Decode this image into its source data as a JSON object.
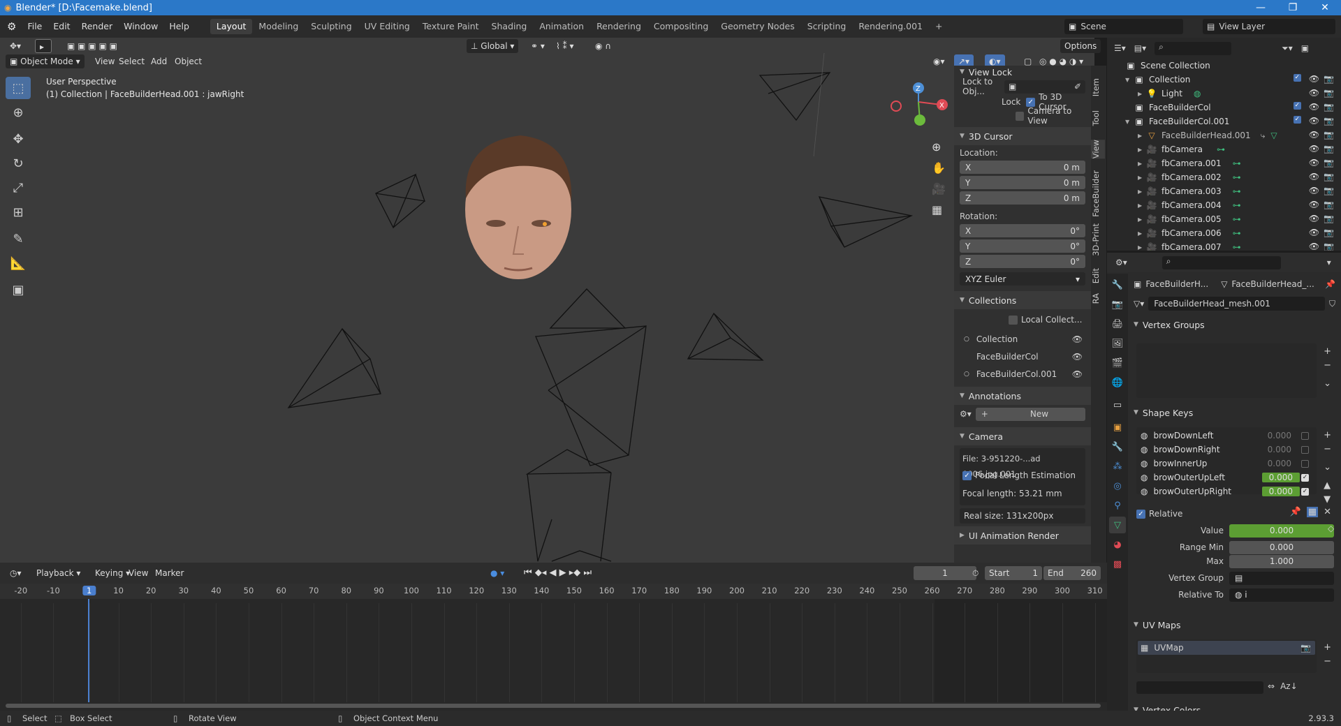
{
  "titlebar": {
    "title": "Blender* [D:\\Facemake.blend]",
    "minimize": "—",
    "restore": "❐",
    "close": "✕"
  },
  "menu": [
    "File",
    "Edit",
    "Render",
    "Window",
    "Help"
  ],
  "workspaces": [
    "Layout",
    "Modeling",
    "Sculpting",
    "UV Editing",
    "Texture Paint",
    "Shading",
    "Animation",
    "Rendering",
    "Compositing",
    "Geometry Nodes",
    "Scripting",
    "Rendering.001",
    "+"
  ],
  "active_workspace": "Layout",
  "scene": {
    "name": "Scene",
    "view_layer": "View Layer"
  },
  "viewport": {
    "mode": "Object Mode",
    "menus": [
      "View",
      "Select",
      "Add",
      "Object"
    ],
    "transform": "Global",
    "options": "Options",
    "overlay_line1": "User Perspective",
    "overlay_line2": "(1) Collection | FaceBuilderHead.001 : jawRight",
    "gizmo": {
      "x": "X",
      "y": "Y",
      "z": "Z"
    }
  },
  "npanel": {
    "view_lock_title": "View Lock",
    "lock_to_obj": "Lock to Obj...",
    "lock": "Lock",
    "to_3d_cursor": "To 3D Cursor",
    "camera_to_view": "Camera to View",
    "cursor_title": "3D Cursor",
    "location": "Location:",
    "rotation": "Rotation:",
    "loc": [
      {
        "axis": "X",
        "val": "0 m"
      },
      {
        "axis": "Y",
        "val": "0 m"
      },
      {
        "axis": "Z",
        "val": "0 m"
      }
    ],
    "rot": [
      {
        "axis": "X",
        "val": "0°"
      },
      {
        "axis": "Y",
        "val": "0°"
      },
      {
        "axis": "Z",
        "val": "0°"
      }
    ],
    "rot_mode": "XYZ Euler",
    "collections_title": "Collections",
    "local_collect": "Local Collect...",
    "collections": [
      "Collection",
      "FaceBuilderCol",
      "FaceBuilderCol.001"
    ],
    "annotations_title": "Annotations",
    "new": "New",
    "camera_title": "Camera",
    "file": "File: 3-951220-...ad 0006.jpg.001",
    "focal_est": "Focal Length Estimation",
    "focal_length": "Focal length: 53.21 mm",
    "real_size": "Real size: 131x200px",
    "ui_anim": "UI Animation Render"
  },
  "sidetabs": [
    "Item",
    "Tool",
    "View",
    "FaceBuilder",
    "3D-Print",
    "Edit",
    "RA"
  ],
  "timeline": {
    "menus": [
      "Playback",
      "Keying",
      "View",
      "Marker"
    ],
    "current": "1",
    "start_label": "Start",
    "start": "1",
    "end_label": "End",
    "end": "260",
    "ticks": [
      "-20",
      "-10",
      "1",
      "10",
      "20",
      "30",
      "40",
      "50",
      "60",
      "70",
      "80",
      "90",
      "100",
      "110",
      "120",
      "130",
      "140",
      "150",
      "160",
      "170",
      "180",
      "190",
      "200",
      "210",
      "220",
      "230",
      "240",
      "250",
      "260",
      "270",
      "280",
      "290",
      "300",
      "310"
    ]
  },
  "outliner": {
    "scene_collection": "Scene Collection",
    "items": [
      "Collection",
      "Light",
      "FaceBuilderCol",
      "FaceBuilderCol.001",
      "FaceBuilderHead.001",
      "fbCamera",
      "fbCamera.001",
      "fbCamera.002",
      "fbCamera.003",
      "fbCamera.004",
      "fbCamera.005",
      "fbCamera.006",
      "fbCamera.007"
    ]
  },
  "properties": {
    "crumb1": "FaceBuilderH...",
    "crumb2": "FaceBuilderHead_...",
    "mesh_name": "FaceBuilderHead_mesh.001",
    "vertex_groups": "Vertex Groups",
    "shape_keys": "Shape Keys",
    "keys": [
      {
        "name": "browDownLeft",
        "value": "0.000"
      },
      {
        "name": "browDownRight",
        "value": "0.000"
      },
      {
        "name": "browInnerUp",
        "value": "0.000"
      },
      {
        "name": "browOuterUpLeft",
        "value": "0.000"
      },
      {
        "name": "browOuterUpRight",
        "value": "0.000"
      }
    ],
    "relative": "Relative",
    "value_label": "Value",
    "value": "0.000",
    "range_min_label": "Range Min",
    "range_min": "0.000",
    "max_label": "Max",
    "max": "1.000",
    "vertex_group_label": "Vertex Group",
    "relative_to_label": "Relative To",
    "relative_to": "i",
    "uv_maps": "UV Maps",
    "uvmap": "UVMap",
    "vertex_colors": "Vertex Colors"
  },
  "status": {
    "select": "Select",
    "box_select": "Box Select",
    "rotate": "Rotate View",
    "context": "Object Context Menu",
    "version": "2.93.3"
  }
}
